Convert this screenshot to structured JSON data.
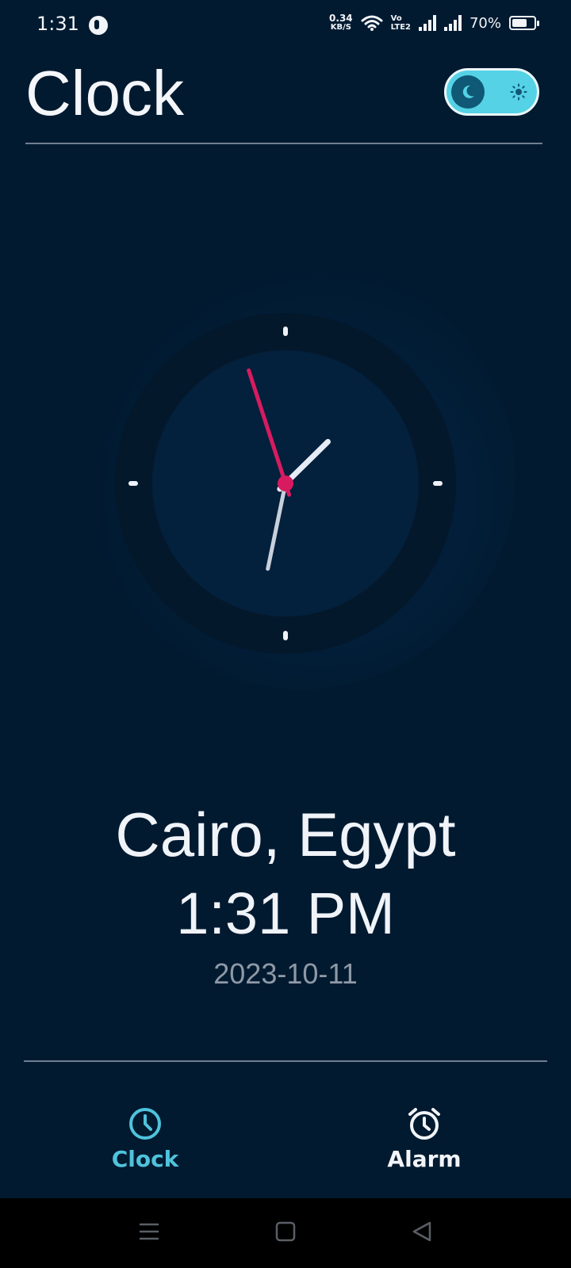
{
  "status_bar": {
    "time": "1:31",
    "net_speed_value": "0.34",
    "net_speed_unit": "KB/S",
    "volte_top": "Vo",
    "volte_bottom": "LTE2",
    "battery_percent": "70%",
    "battery_level": 0.7
  },
  "header": {
    "title": "Clock",
    "theme_toggle": {
      "mode": "dark"
    }
  },
  "clock": {
    "hour": 13,
    "minute": 31,
    "second": 57,
    "second_hand_color": "#d81b60",
    "hand_color": "#e6ecf5"
  },
  "location": {
    "city": "Cairo, Egypt",
    "time": "1:31 PM",
    "date": "2023-10-11"
  },
  "bottom_nav": {
    "items": [
      {
        "label": "Clock",
        "icon": "clock-icon",
        "active": true
      },
      {
        "label": "Alarm",
        "icon": "alarm-clock-icon",
        "active": false
      }
    ]
  },
  "colors": {
    "background": "#011a30",
    "accent": "#4fc3dc",
    "toggle": "#55d2e6"
  }
}
